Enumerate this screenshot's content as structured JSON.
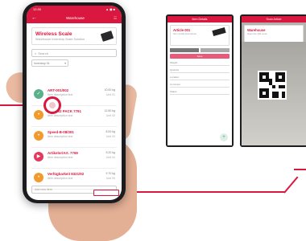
{
  "colors": {
    "accent": "#d9173f",
    "orange": "#f29a2e",
    "green": "#5ab08a",
    "pink": "#e13a5c"
  },
  "phone": {
    "status_time": "12:30",
    "status_icons": "▲ ◼ ■",
    "appbar": {
      "title": "Warehouse",
      "back_icon": "arrow-left-icon",
      "menu_icon": "grid-icon"
    },
    "header": {
      "title": "Wireless Scale",
      "subtitle": "Warehouse Inventory Scale Solution"
    },
    "search": {
      "placeholder": "Search"
    },
    "filter": {
      "value": "Inventory 01"
    },
    "rows": [
      {
        "title": "ART-001/002",
        "sub": "Item description text",
        "right1": "10.00 kg",
        "right2": "Unit 01",
        "color": "#5ab08a",
        "icon": "✓"
      },
      {
        "title": "ART-002 PACK 7791",
        "sub": "Item description text",
        "right1": "12.50 kg",
        "right2": "Unit 02",
        "color": "#f29a2e",
        "icon": "•"
      },
      {
        "title": "Speed-B-08/301",
        "sub": "Item description text",
        "right1": "8.00 kg",
        "right2": "Unit 03",
        "color": "#f29a2e",
        "icon": "•"
      },
      {
        "title": "Artikelnr/Art. 7769",
        "sub": "Item description text",
        "right1": "5.20 kg",
        "right2": "Unit 04",
        "color": "#e13a5c",
        "icon": "▶"
      },
      {
        "title": "Verfügbarkeit 8321/92",
        "sub": "Item description text",
        "right1": "9.70 kg",
        "right2": "Unit 05",
        "color": "#f29a2e",
        "icon": "•"
      }
    ],
    "bottom": {
      "label": "Add new item"
    }
  },
  "mini1": {
    "title": "Item Details",
    "card_title": "Article 001",
    "card_sub": "Item detail description",
    "button": "Save",
    "fields": [
      "Weight",
      "Quantity",
      "Location",
      "Comment",
      "Status"
    ]
  },
  "mini2": {
    "title": "Scan Article",
    "card_title": "Warehouse",
    "card_sub": "Scan the QR code"
  }
}
